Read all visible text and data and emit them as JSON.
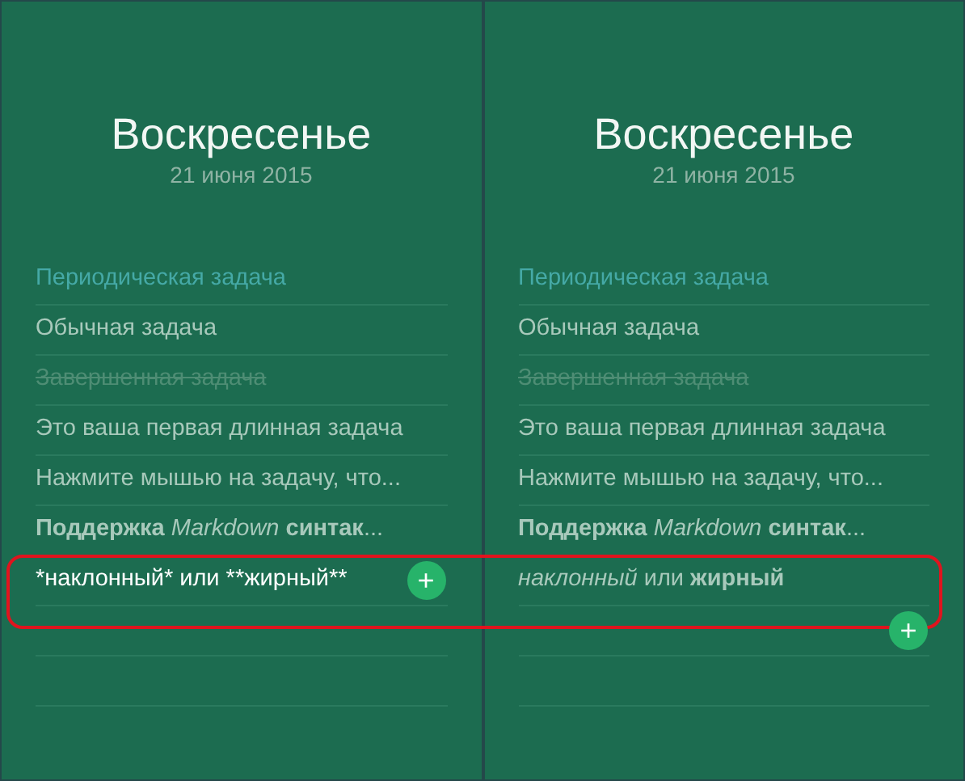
{
  "highlight": true,
  "panels": [
    {
      "day": "Воскресенье",
      "date": "21 июня 2015",
      "tasks": [
        {
          "kind": "recurring",
          "text": "Периодическая задача"
        },
        {
          "kind": "normal",
          "text": "Обычная задача"
        },
        {
          "kind": "done",
          "text": "Завершенная задача"
        },
        {
          "kind": "normal",
          "text": "Это ваша первая длинная задача"
        },
        {
          "kind": "normal",
          "text": "Нажмите мышью на задачу, что..."
        },
        {
          "kind": "normal",
          "text": "**Поддержка** *Markdown* **синтак**..."
        },
        {
          "kind": "editing",
          "text": "*наклонный* или **жирный**"
        }
      ],
      "add_button": "+"
    },
    {
      "day": "Воскресенье",
      "date": "21 июня 2015",
      "tasks": [
        {
          "kind": "recurring",
          "text": "Периодическая задача"
        },
        {
          "kind": "normal",
          "text": "Обычная задача"
        },
        {
          "kind": "done",
          "text": "Завершенная задача"
        },
        {
          "kind": "normal",
          "text": "Это ваша первая длинная задача"
        },
        {
          "kind": "normal",
          "text": "Нажмите мышью на задачу, что..."
        },
        {
          "kind": "normal",
          "text": "**Поддержка** *Markdown* **синтак**..."
        },
        {
          "kind": "normal",
          "text": "*наклонный* или **жирный**"
        }
      ],
      "add_button": "+"
    }
  ]
}
